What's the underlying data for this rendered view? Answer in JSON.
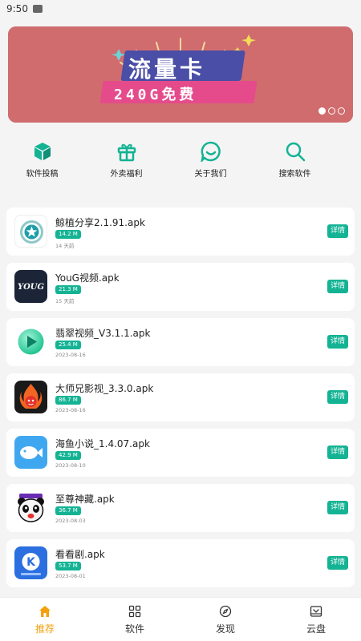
{
  "status_bar": {
    "time": "9:50"
  },
  "banner": {
    "title": "流量卡",
    "subtitle": "240G免费",
    "page_count": 3,
    "active_index": 0,
    "colors": {
      "background": "#d06c6e",
      "title_box": "#4a4ea6",
      "subtitle_box": "#e54b8b"
    }
  },
  "quick_nav": [
    {
      "label": "软件投稿",
      "icon": "cube-icon"
    },
    {
      "label": "外卖福利",
      "icon": "gift-icon"
    },
    {
      "label": "关于我们",
      "icon": "chat-smile-icon"
    },
    {
      "label": "搜索软件",
      "icon": "search-icon"
    }
  ],
  "apps": [
    {
      "name": "鲸植分享2.1.91.apk",
      "size": "14.2 M",
      "date": "14 天前",
      "action": "详情",
      "icon": "star-circle-icon"
    },
    {
      "name": "YouG视频.apk",
      "size": "21.3 M",
      "date": "15 天前",
      "action": "详情",
      "icon": "youg-logo-icon"
    },
    {
      "name": "翡翠视频_V3.1.1.apk",
      "size": "25.4 M",
      "date": "2023-08-16",
      "action": "详情",
      "icon": "play-ball-icon"
    },
    {
      "name": "大师兄影视_3.3.0.apk",
      "size": "86.7 M",
      "date": "2023-08-16",
      "action": "详情",
      "icon": "monkey-flame-icon"
    },
    {
      "name": "海鱼小说_1.4.07.apk",
      "size": "42.9 M",
      "date": "2023-08-10",
      "action": "详情",
      "icon": "fish-icon"
    },
    {
      "name": "至尊神藏.apk",
      "size": "36.7 M",
      "date": "2023-08-03",
      "action": "详情",
      "icon": "panda-icon"
    },
    {
      "name": "看看剧.apk",
      "size": "53.7 M",
      "date": "2023-08-01",
      "action": "详情",
      "icon": "k-logo-icon"
    }
  ],
  "tabs": [
    {
      "label": "推荐",
      "icon": "home-icon",
      "active": true
    },
    {
      "label": "软件",
      "icon": "grid-icon",
      "active": false
    },
    {
      "label": "发现",
      "icon": "compass-icon",
      "active": false
    },
    {
      "label": "云盘",
      "icon": "cloud-drive-icon",
      "active": false
    }
  ],
  "colors": {
    "accent": "#14b394",
    "active_tab": "#f4a10e"
  }
}
